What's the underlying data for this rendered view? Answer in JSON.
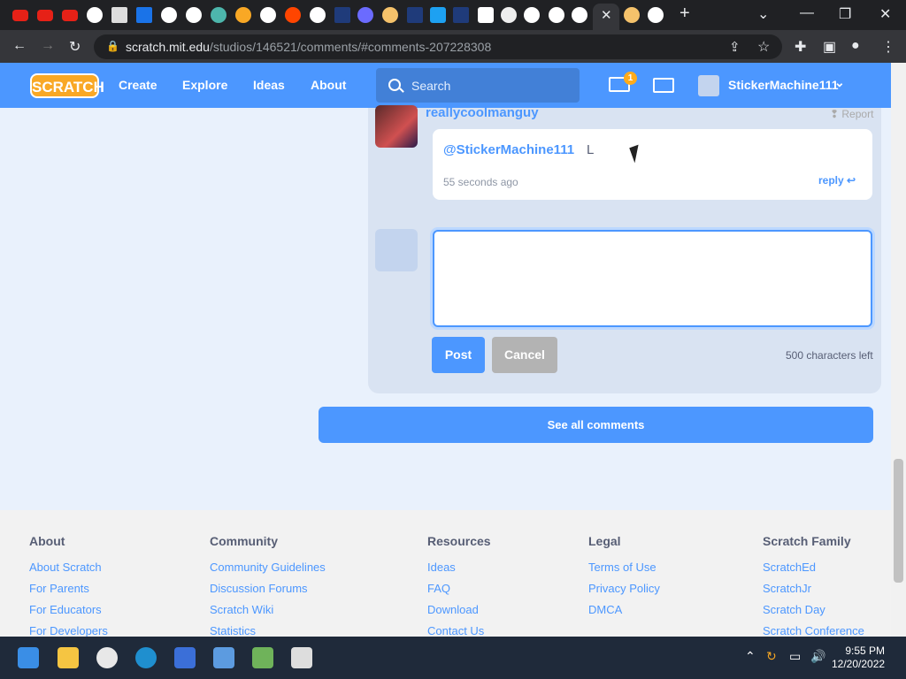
{
  "browser": {
    "url_host": "scratch.mit.edu",
    "url_path": "/studios/146521/comments/#comments-207228308"
  },
  "nav": {
    "logo": "SCRATCH",
    "links": [
      "Create",
      "Explore",
      "Ideas",
      "About"
    ],
    "search_placeholder": "Search",
    "messages_count": "1",
    "username": "StickerMachine111"
  },
  "comment": {
    "author": "reallycoolmanguy",
    "report": "Report",
    "mention": "@StickerMachine111",
    "text": "L",
    "time": "55 seconds ago",
    "reply": "reply"
  },
  "compose": {
    "post": "Post",
    "cancel": "Cancel",
    "chars_left": "500 characters left"
  },
  "see_all": "See all comments",
  "footer": {
    "about": {
      "title": "About",
      "links": [
        "About Scratch",
        "For Parents",
        "For Educators",
        "For Developers"
      ]
    },
    "community": {
      "title": "Community",
      "links": [
        "Community Guidelines",
        "Discussion Forums",
        "Scratch Wiki",
        "Statistics"
      ]
    },
    "resources": {
      "title": "Resources",
      "links": [
        "Ideas",
        "FAQ",
        "Download",
        "Contact Us"
      ]
    },
    "legal": {
      "title": "Legal",
      "links": [
        "Terms of Use",
        "Privacy Policy",
        "DMCA"
      ]
    },
    "family": {
      "title": "Scratch Family",
      "links": [
        "ScratchEd",
        "ScratchJr",
        "Scratch Day",
        "Scratch Conference"
      ]
    }
  },
  "taskbar": {
    "time": "9:55 PM",
    "date": "12/20/2022"
  },
  "colors": {
    "accent": "#4c97ff",
    "nav": "#4c97ff",
    "orange": "#ffab1a"
  }
}
